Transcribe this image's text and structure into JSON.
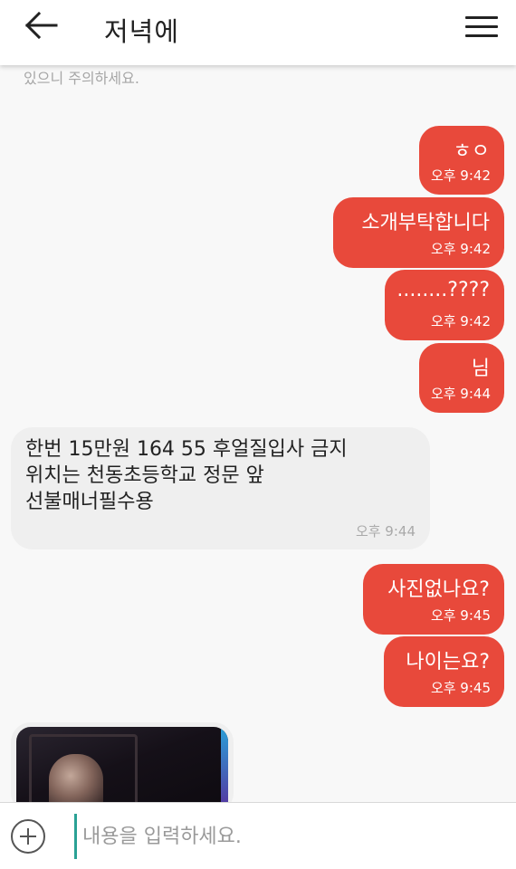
{
  "header": {
    "title": "저녁에",
    "back_icon": "arrow-left-icon",
    "menu_icon": "hamburger-menu-icon"
  },
  "notice": "있으니 주의하세요.",
  "messages": [
    {
      "dir": "out",
      "text": "ㅎㅇ",
      "time": "오후 9:42"
    },
    {
      "dir": "out",
      "text": "소개부탁합니다",
      "time": "오후 9:42"
    },
    {
      "dir": "out",
      "text": "........????",
      "time": "오후 9:42"
    },
    {
      "dir": "out",
      "text": "님",
      "time": "오후 9:44"
    },
    {
      "dir": "in",
      "lines": [
        "한번 15만원 164 55 후얼질입사 금지",
        "위치는 천동초등학교 정문 앞",
        "선불매너필수용"
      ],
      "time": "오후 9:44"
    },
    {
      "dir": "out",
      "text": "사진없나요?",
      "time": "오후 9:45"
    },
    {
      "dir": "out",
      "text": "나이는요?",
      "time": "오후 9:45"
    }
  ],
  "input": {
    "placeholder": "내용을 입력하세요.",
    "value": "",
    "add_icon": "plus-circle-icon"
  },
  "colors": {
    "outgoing_bubble": "#e8493b",
    "incoming_bubble": "#efefef",
    "background": "#f8f8f8",
    "cursor_accent": "#2aa195"
  }
}
